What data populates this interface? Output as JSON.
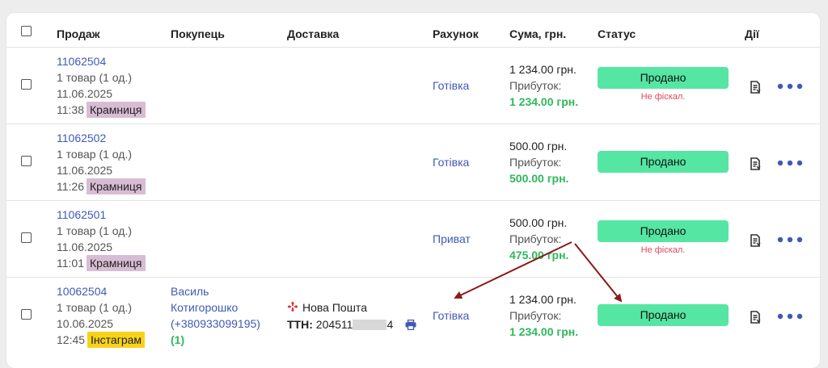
{
  "headers": {
    "sale": "Продаж",
    "buyer": "Покупець",
    "delivery": "Доставка",
    "account": "Рахунок",
    "sum": "Сума, грн.",
    "status": "Статус",
    "actions": "Дії"
  },
  "rows": [
    {
      "id": "11062504",
      "items": "1 товар (1 од.)",
      "date": "11.06.2025",
      "time": "11:38",
      "channel": "Крамниця",
      "account": "Готівка",
      "sum": "1 234.00 грн.",
      "profit_label": "Прибуток:",
      "profit": "1 234.00 грн.",
      "status": "Продано",
      "fiscal": "Не фіскал."
    },
    {
      "id": "11062502",
      "items": "1 товар (1 од.)",
      "date": "11.06.2025",
      "time": "11:26",
      "channel": "Крамниця",
      "account": "Готівка",
      "sum": "500.00 грн.",
      "profit_label": "Прибуток:",
      "profit": "500.00 грн.",
      "status": "Продано",
      "fiscal": ""
    },
    {
      "id": "11062501",
      "items": "1 товар (1 од.)",
      "date": "11.06.2025",
      "time": "11:01",
      "channel": "Крамниця",
      "account": "Приват",
      "sum": "500.00 грн.",
      "profit_label": "Прибуток:",
      "profit": "475.00 грн.",
      "status": "Продано",
      "fiscal": "Не фіскал."
    },
    {
      "id": "10062504",
      "items": "1 товар (1 од.)",
      "date": "10.06.2025",
      "time": "12:45",
      "channel": "Інстаграм",
      "buyer_name_1": "Василь",
      "buyer_name_2": "Котигорошко",
      "buyer_phone": "(+380933099195)",
      "buyer_count": "(1)",
      "delivery_carrier": "Нова Пошта",
      "ttn_label": "ТТН:",
      "ttn_start": "204511",
      "ttn_end": "4",
      "account": "Готівка",
      "sum": "1 234.00 грн.",
      "profit_label": "Прибуток:",
      "profit": "1 234.00 грн.",
      "status": "Продано",
      "fiscal": ""
    }
  ],
  "colors": {
    "link": "#3f5ab4",
    "status_green": "#55e6a3",
    "profit_green": "#2eb85c",
    "fiscal_red": "#e0495f",
    "tag_shop": "#d8bcd4",
    "tag_insta": "#f7d21b",
    "arrow": "#8b1a1a",
    "novaposhta_red": "#e0262d"
  }
}
